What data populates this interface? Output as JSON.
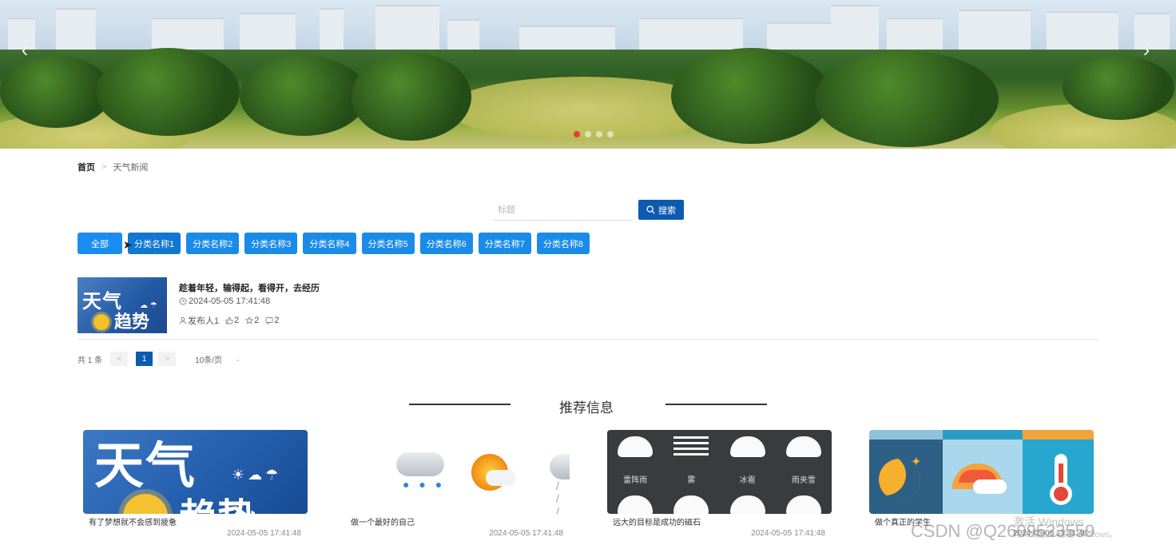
{
  "banner": {
    "prev_arrow": "‹",
    "next_arrow": "›",
    "dots": 4
  },
  "breadcrumb": {
    "home": "首页",
    "separator": ">",
    "current": "天气新闻"
  },
  "search": {
    "placeholder": "标题",
    "value": "",
    "button_label": "搜索"
  },
  "categories": [
    "全部",
    "分类名称1",
    "分类名称2",
    "分类名称3",
    "分类名称4",
    "分类名称5",
    "分类名称6",
    "分类名称7",
    "分类名称8"
  ],
  "news": [
    {
      "thumb_line1": "天气",
      "thumb_line2": "趋势",
      "title": "趁着年轻，输得起，看得开，去经历",
      "time": "2024-05-05 17:41:48",
      "author": "发布人1",
      "likes": "2",
      "favorites": "2",
      "comments": "2"
    }
  ],
  "pager": {
    "total": "共 1 条",
    "prev": "<",
    "current_page": "1",
    "next": ">",
    "page_size": "10条/页"
  },
  "recommend": {
    "title": "推荐信息",
    "items": [
      {
        "image_big": "天气",
        "image_big2": "趋势",
        "caption": "有了梦想就不会感到疲惫",
        "date": "2024-05-05 17:41:48"
      },
      {
        "caption": "做一个最好的自己",
        "date": "2024-05-05 17:41:48"
      },
      {
        "labels": [
          "雷阵雨",
          "雾",
          "冰雹",
          "雨夹雪"
        ],
        "caption": "远大的目标是成功的磁石",
        "date": "2024-05-05 17:41:48"
      },
      {
        "caption": "做个真正的学生",
        "date": "2024-05-05 17:41:48"
      }
    ]
  },
  "watermark": {
    "csdn": "CSDN @Q2609523559",
    "windows": "激活 Windows",
    "windows_sub": "转到\"设置\"以激活 Windows。"
  },
  "colors": {
    "primary": "#0d5bb0",
    "category": "#1a8be8",
    "active_dot": "#e3402e"
  }
}
